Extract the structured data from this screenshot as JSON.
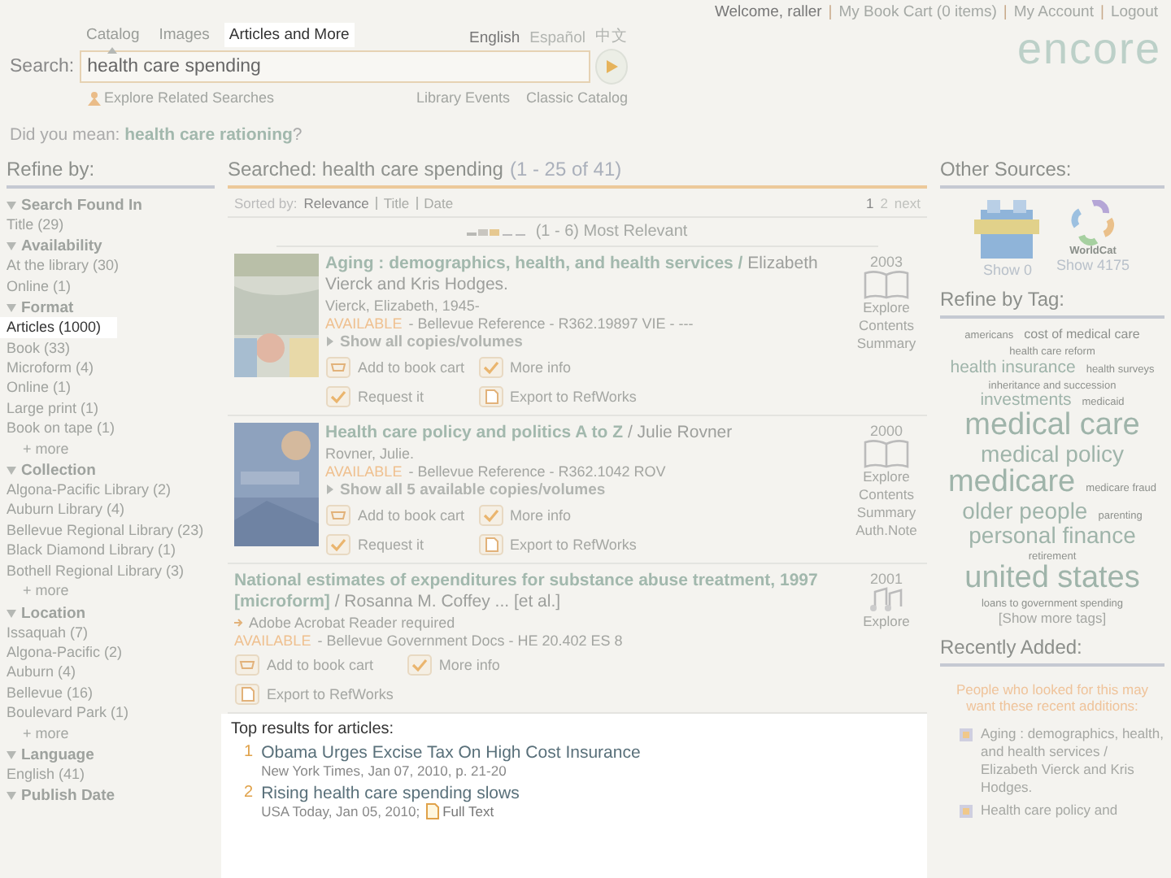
{
  "header": {
    "user_links": [
      {
        "kind": "text",
        "label": "Welcome, raller"
      },
      {
        "kind": "separator",
        "label": "|"
      },
      {
        "kind": "link",
        "label": "My Book Cart (0 items)"
      },
      {
        "kind": "separator",
        "label": "|"
      },
      {
        "kind": "link",
        "label": "My Account"
      },
      {
        "kind": "separator",
        "label": "|"
      },
      {
        "kind": "link",
        "label": "Logout"
      }
    ],
    "tabs": [
      {
        "label": "Catalog",
        "selected": true,
        "highlighted": false
      },
      {
        "label": "Images",
        "selected": false,
        "highlighted": false
      },
      {
        "label": "Articles and More",
        "selected": false,
        "highlighted": true
      }
    ],
    "languages": [
      {
        "label": "English",
        "selected": true
      },
      {
        "label": "Español",
        "selected": false
      },
      {
        "label": "中文",
        "selected": false
      }
    ],
    "search": {
      "label": "Search:",
      "value": "health care spending"
    },
    "explore_link": "Explore Related Searches",
    "links": [
      "Library Events",
      "Classic Catalog"
    ],
    "logo": "encore"
  },
  "suggestion": {
    "prefix": "Did you mean: ",
    "term": "health care rationing",
    "suffix": "?"
  },
  "refine": {
    "title": "Refine by:",
    "facets": [
      {
        "title": "Search Found In",
        "items": [
          {
            "label": "Title (29)",
            "highlighted": false
          }
        ]
      },
      {
        "title": "Availability",
        "items": [
          {
            "label": "At the library (30)",
            "highlighted": false
          },
          {
            "label": "Online (1)",
            "highlighted": false
          }
        ]
      },
      {
        "title": "Format",
        "items": [
          {
            "label": "Articles (1000)",
            "highlighted": true
          },
          {
            "label": "Book (33)",
            "highlighted": false
          },
          {
            "label": "Microform (4)",
            "highlighted": false
          },
          {
            "label": "Online (1)",
            "highlighted": false
          },
          {
            "label": "Large print (1)",
            "highlighted": false
          },
          {
            "label": "Book on tape (1)",
            "highlighted": false
          }
        ],
        "more": "+ more"
      },
      {
        "title": "Collection",
        "items": [
          {
            "label": "Algona-Pacific Library (2)",
            "highlighted": false
          },
          {
            "label": "Auburn Library (4)",
            "highlighted": false
          },
          {
            "label": "Bellevue Regional Library (23)",
            "highlighted": false
          },
          {
            "label": "Black Diamond Library (1)",
            "highlighted": false
          },
          {
            "label": "Bothell Regional Library (3)",
            "highlighted": false
          }
        ],
        "more": "+ more"
      },
      {
        "title": "Location",
        "items": [
          {
            "label": "Issaquah (7)",
            "highlighted": false
          },
          {
            "label": "Algona-Pacific (2)",
            "highlighted": false
          },
          {
            "label": "Auburn (4)",
            "highlighted": false
          },
          {
            "label": "Bellevue (16)",
            "highlighted": false
          },
          {
            "label": "Boulevard Park (1)",
            "highlighted": false
          }
        ],
        "more": "+ more"
      },
      {
        "title": "Language",
        "items": [
          {
            "label": "English (41)",
            "highlighted": false
          }
        ]
      },
      {
        "title": "Publish Date"
      }
    ]
  },
  "results": {
    "searched": "Searched: health care spending",
    "range": "(1 - 25 of 41)",
    "sort_label": "Sorted by:",
    "sort_options": [
      {
        "label": "Relevance",
        "selected": true
      },
      {
        "label": "Title",
        "selected": false
      },
      {
        "label": "Date",
        "selected": false
      }
    ],
    "pages": [
      {
        "label": "1",
        "selected": true
      },
      {
        "label": "2",
        "selected": false
      },
      {
        "label": "next",
        "selected": false
      }
    ],
    "relevance": "(1 - 6) Most Relevant",
    "items": [
      {
        "kind": "book",
        "cover": true,
        "title": "Aging : demographics, health, and health services /",
        "title_rest": "Elizabeth Vierck and Kris Hodges.",
        "author": "Vierck, Elizabeth, 1945-",
        "status": "AVAILABLE",
        "holding": "-   Bellevue Reference   -   R362.19897 VIE   -   ---",
        "copies": "Show all copies/volumes",
        "actions": [
          "Add to book cart",
          "More info",
          "Request it",
          "Export to RefWorks"
        ],
        "year": "2003",
        "side_links": [
          "Explore",
          "Contents",
          "Summary"
        ]
      },
      {
        "kind": "book",
        "cover": true,
        "title": "Health care policy and politics A to Z",
        "title_rest": "/ Julie Rovner",
        "author": "Rovner, Julie.",
        "status": "AVAILABLE",
        "holding": "-   Bellevue Reference   -   R362.1042 ROV",
        "copies": "Show all 5 available copies/volumes",
        "actions": [
          "Add to book cart",
          "More info",
          "Request it",
          "Export to RefWorks"
        ],
        "year": "2000",
        "side_links": [
          "Explore",
          "Contents",
          "Summary",
          "Auth.Note"
        ]
      },
      {
        "kind": "audio",
        "cover": false,
        "title": "National estimates of expenditures for substance abuse treatment, 1997 [microform]",
        "title_rest": "/ Rosanna M. Coffey ... [et al.]",
        "note": "Adobe Acrobat Reader required",
        "status": "AVAILABLE",
        "holding": "-   Bellevue Government Docs   -   HE 20.402 ES 8",
        "actions": [
          "Add to book cart",
          "More info",
          "Export to RefWorks"
        ],
        "year": "2001",
        "side_links": [
          "Explore"
        ]
      }
    ]
  },
  "top_articles": {
    "title": "Top results for articles:",
    "highlighted": true,
    "items": [
      {
        "number": "1",
        "title": "Obama Urges Excise Tax On High Cost Insurance",
        "source": "New York Times, Jan 07, 2010, p. 21-20"
      },
      {
        "number": "2",
        "title": "Rising health care spending slows",
        "source": "USA Today, Jan 05, 2010;",
        "full_text": "Full Text"
      }
    ]
  },
  "other_sources": {
    "title": "Other Sources:",
    "items": [
      {
        "kind": "connect",
        "label": "Show 0"
      },
      {
        "kind": "worldcat",
        "logo_text": "WorldCat",
        "label": "Show 4175"
      }
    ]
  },
  "tags": {
    "title": "Refine by Tag:",
    "items": [
      {
        "label": "americans",
        "kind": "xs"
      },
      {
        "label": "cost of medical care",
        "kind": "s"
      },
      {
        "label": "health care reform",
        "kind": "xs"
      },
      {
        "label": "health insurance",
        "kind": "m"
      },
      {
        "label": "health surveys",
        "kind": "xs"
      },
      {
        "label": "inheritance and succession",
        "kind": "xs"
      },
      {
        "label": "investments",
        "kind": "m"
      },
      {
        "label": "medicaid",
        "kind": "xs"
      },
      {
        "label": "medical care",
        "kind": "xl"
      },
      {
        "label": "medical policy",
        "kind": "l"
      },
      {
        "label": "medicare",
        "kind": "xl"
      },
      {
        "label": "medicare fraud",
        "kind": "xs"
      },
      {
        "label": "older people",
        "kind": "l"
      },
      {
        "label": "parenting",
        "kind": "xs"
      },
      {
        "label": "personal finance",
        "kind": "l"
      },
      {
        "label": "retirement",
        "kind": "xs"
      },
      {
        "label": "united states",
        "kind": "xl"
      },
      {
        "label": "loans to government spending",
        "kind": "xs"
      }
    ],
    "more": "[Show more tags]"
  },
  "recent": {
    "title": "Recently Added:",
    "intro": "People who looked for this may want these recent additions:",
    "items": [
      "Aging : demographics, health, and health services / Elizabeth Vierck and Kris Hodges.",
      "Health care policy and"
    ]
  }
}
